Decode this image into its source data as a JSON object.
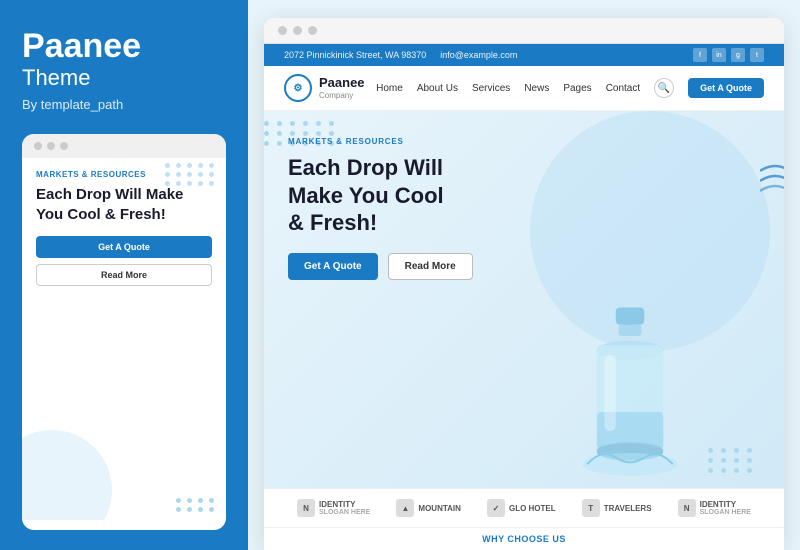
{
  "left": {
    "brand": {
      "title": "Paanee",
      "subtitle": "Theme",
      "by": "By template_path"
    },
    "mobile_preview": {
      "markets_label": "MARKETS & RESOURCES",
      "headline": "Each Drop Will Make You Cool & Fresh!",
      "btn_quote": "Get A Quote",
      "btn_read": "Read More"
    }
  },
  "right": {
    "topbar": {
      "address": "2072 Pinnickinick Street, WA 98370",
      "email": "info@example.com"
    },
    "navbar": {
      "logo_text": "Paanee",
      "logo_sub": "Company",
      "nav_items": [
        "Home",
        "About Us",
        "Services",
        "News",
        "Pages",
        "Contact"
      ],
      "btn_quote": "Get A Quote"
    },
    "hero": {
      "markets_label": "MARKETS & RESOURCES",
      "headline_line1": "Each Drop Will",
      "headline_line2": "Make You Cool",
      "headline_line3": "& Fresh!",
      "btn_quote": "Get A Quote",
      "btn_read": "Read More"
    },
    "logos": [
      {
        "name": "IDENTITY",
        "sub": "SLOGAN HERE"
      },
      {
        "name": "MOUNTAIN",
        "sub": ""
      },
      {
        "name": "✓GLO HOTEL",
        "sub": ""
      },
      {
        "name": "TRAVELERS",
        "sub": ""
      },
      {
        "name": "IDENTITY",
        "sub": "SLOGAN HERE"
      }
    ],
    "why_choose": "WHY CHOOSE US"
  },
  "colors": {
    "brand_blue": "#1a7bc4",
    "dark": "#1a1a2e",
    "light_bg": "#e8f4fb"
  }
}
